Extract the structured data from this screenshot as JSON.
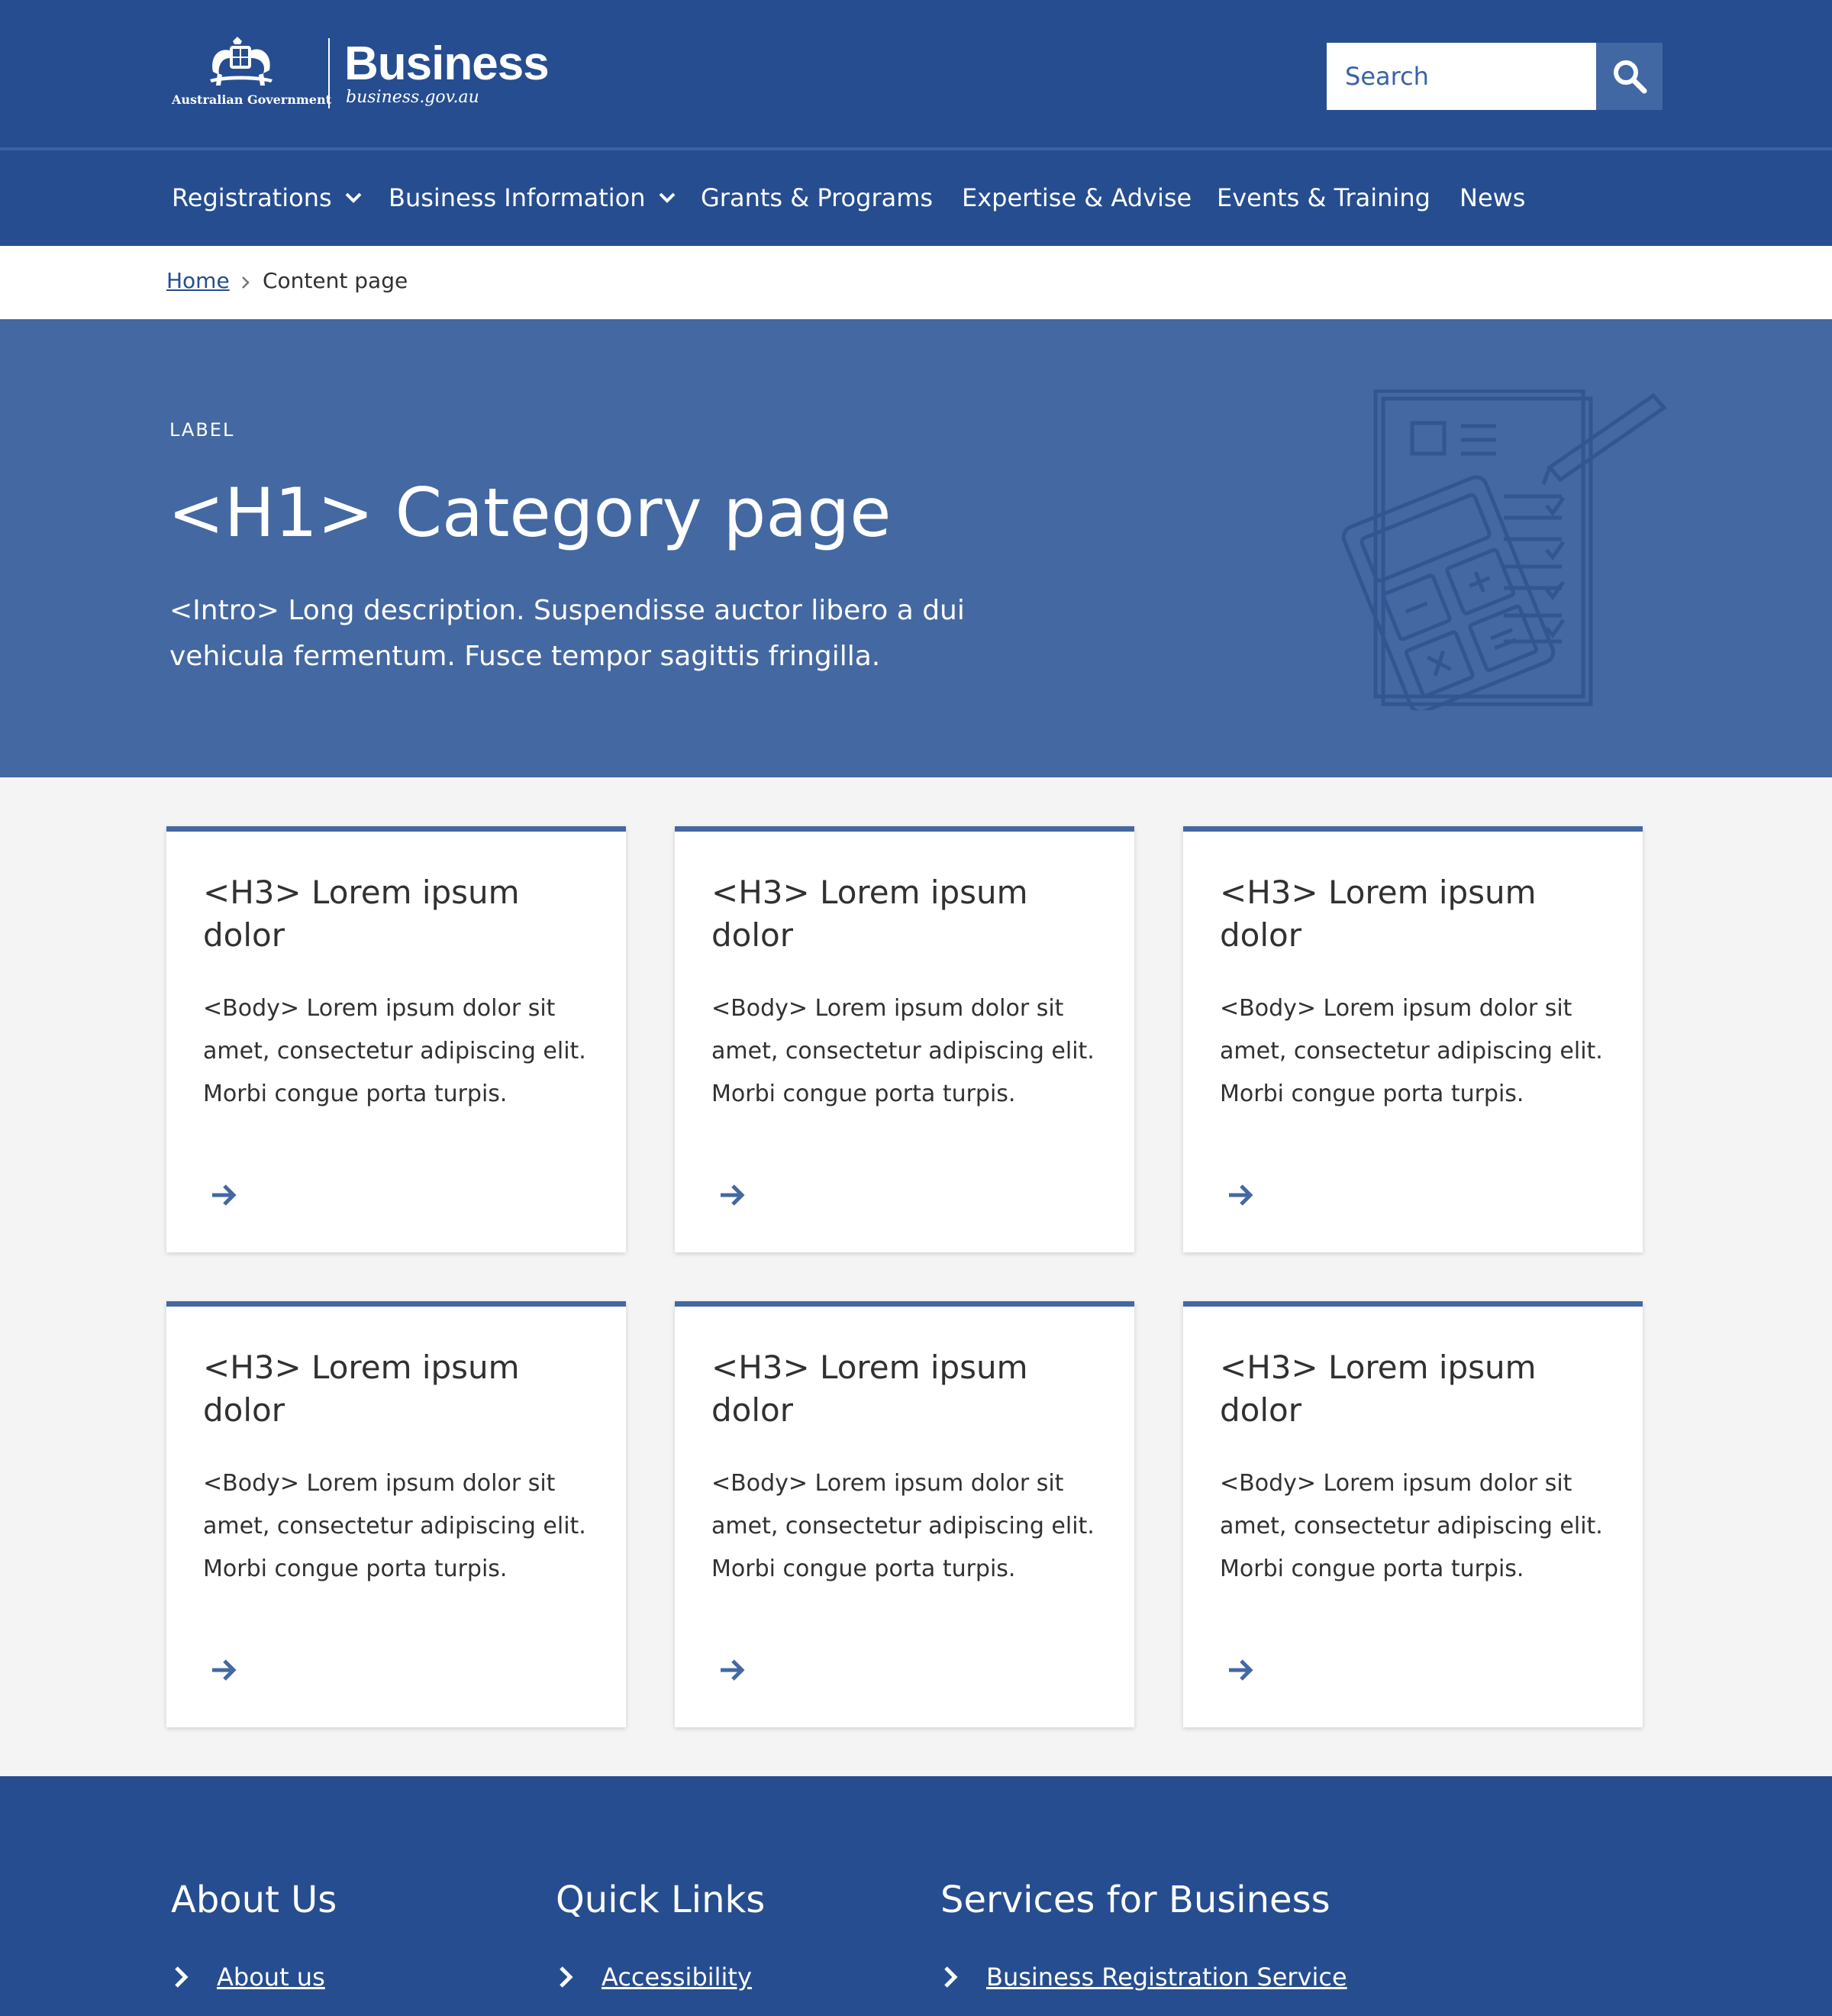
{
  "header": {
    "gov_name": "Australian Government",
    "site_title": "Business",
    "site_url": "business.gov.au",
    "search_placeholder": "Search"
  },
  "nav": {
    "items": [
      {
        "label": "Registrations",
        "has_dropdown": true
      },
      {
        "label": "Business Information",
        "has_dropdown": true
      },
      {
        "label": "Grants & Programs",
        "has_dropdown": false
      },
      {
        "label": "Expertise & Advise",
        "has_dropdown": false
      },
      {
        "label": "Events & Training",
        "has_dropdown": false
      },
      {
        "label": "News",
        "has_dropdown": false
      }
    ]
  },
  "breadcrumb": {
    "home": "Home",
    "current": "Content page"
  },
  "hero": {
    "label": "LABEL",
    "title": "<H1> Category page",
    "intro": "<Intro> Long description. Suspendisse auctor libero a dui vehicula fermentum. Fusce tempor sagittis fringilla."
  },
  "cards": [
    {
      "title": "<H3> Lorem ipsum dolor",
      "body": "<Body> Lorem ipsum dolor sit amet, consectetur adipiscing elit. Morbi congue porta turpis."
    },
    {
      "title": "<H3> Lorem ipsum dolor",
      "body": "<Body> Lorem ipsum dolor sit amet, consectetur adipiscing elit. Morbi congue porta turpis."
    },
    {
      "title": "<H3> Lorem ipsum dolor",
      "body": "<Body> Lorem ipsum dolor sit amet, consectetur adipiscing elit. Morbi congue porta turpis."
    },
    {
      "title": "<H3> Lorem ipsum dolor",
      "body": "<Body> Lorem ipsum dolor sit amet, consectetur adipiscing elit. Morbi congue porta turpis."
    },
    {
      "title": "<H3> Lorem ipsum dolor",
      "body": "<Body> Lorem ipsum dolor sit amet, consectetur adipiscing elit. Morbi congue porta turpis."
    },
    {
      "title": "<H3> Lorem ipsum dolor",
      "body": "<Body> Lorem ipsum dolor sit amet, consectetur adipiscing elit. Morbi congue porta turpis."
    }
  ],
  "footer": {
    "columns": [
      {
        "heading": "About Us",
        "link": "About us"
      },
      {
        "heading": "Quick Links",
        "link": "Accessibility"
      },
      {
        "heading": "Services for Business",
        "link": "Business Registration Service"
      }
    ]
  },
  "colors": {
    "header_bg": "#264d8f",
    "hero_bg": "#4468a1",
    "accent": "#4468a1",
    "page_bg": "#f4f4f4"
  },
  "icons": {
    "search": "search-icon",
    "dropdown": "chevron-down-icon",
    "breadcrumb_sep": "chevron-right-icon",
    "card_link": "arrow-right-icon",
    "footer_link": "chevron-right-icon"
  }
}
